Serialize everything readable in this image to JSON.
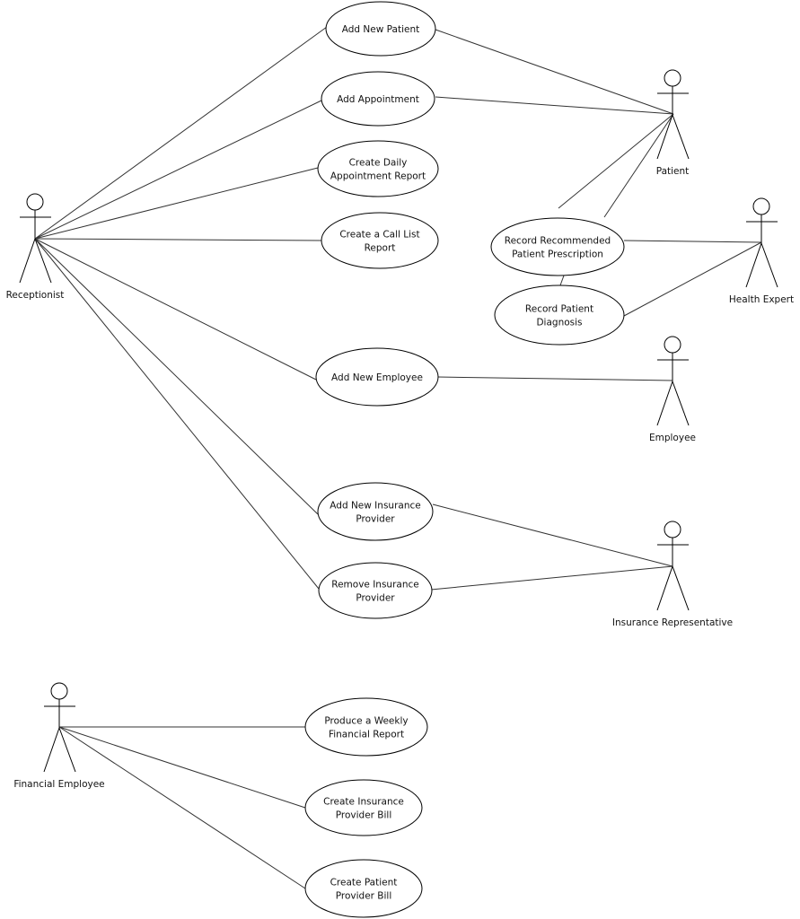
{
  "colors": {
    "stroke": "#000000",
    "line": "#333333",
    "fill": "#ffffff"
  },
  "actors": [
    {
      "id": "receptionist",
      "label": "Receptionist"
    },
    {
      "id": "patient",
      "label": "Patient"
    },
    {
      "id": "health_expert",
      "label": "Health Expert"
    },
    {
      "id": "employee",
      "label": "Employee"
    },
    {
      "id": "insurance_rep",
      "label": "Insurance Representative"
    },
    {
      "id": "financial_employee",
      "label": "Financial Employee"
    }
  ],
  "use_cases": [
    {
      "id": "add_patient",
      "lines": [
        "Add New Patient"
      ]
    },
    {
      "id": "add_appointment",
      "lines": [
        "Add Appointment"
      ]
    },
    {
      "id": "daily_report",
      "lines": [
        "Create Daily",
        "Appointment Report"
      ]
    },
    {
      "id": "call_list",
      "lines": [
        "Create a Call List",
        "Report"
      ]
    },
    {
      "id": "prescription",
      "lines": [
        "Record Recommended",
        "Patient Prescription"
      ]
    },
    {
      "id": "diagnosis",
      "lines": [
        "Record Patient",
        "Diagnosis"
      ]
    },
    {
      "id": "add_employee",
      "lines": [
        "Add New Employee"
      ]
    },
    {
      "id": "add_insurance",
      "lines": [
        "Add New Insurance",
        "Provider"
      ]
    },
    {
      "id": "remove_insurance",
      "lines": [
        "Remove Insurance",
        "Provider"
      ]
    },
    {
      "id": "weekly_report",
      "lines": [
        "Produce a Weekly",
        "Financial Report"
      ]
    },
    {
      "id": "insurance_bill",
      "lines": [
        "Create Insurance",
        "Provider Bill"
      ]
    },
    {
      "id": "patient_bill",
      "lines": [
        "Create Patient",
        "Provider Bill"
      ]
    }
  ],
  "associations": [
    [
      "receptionist",
      "add_patient"
    ],
    [
      "receptionist",
      "add_appointment"
    ],
    [
      "receptionist",
      "daily_report"
    ],
    [
      "receptionist",
      "call_list"
    ],
    [
      "receptionist",
      "add_employee"
    ],
    [
      "receptionist",
      "add_insurance"
    ],
    [
      "receptionist",
      "remove_insurance"
    ],
    [
      "patient",
      "add_patient"
    ],
    [
      "patient",
      "add_appointment"
    ],
    [
      "patient",
      "prescription"
    ],
    [
      "patient",
      "prescription"
    ],
    [
      "health_expert",
      "prescription"
    ],
    [
      "health_expert",
      "diagnosis"
    ],
    [
      "prescription",
      "diagnosis"
    ],
    [
      "employee",
      "add_employee"
    ],
    [
      "insurance_rep",
      "add_insurance"
    ],
    [
      "insurance_rep",
      "remove_insurance"
    ],
    [
      "financial_employee",
      "weekly_report"
    ],
    [
      "financial_employee",
      "insurance_bill"
    ],
    [
      "financial_employee",
      "patient_bill"
    ]
  ]
}
